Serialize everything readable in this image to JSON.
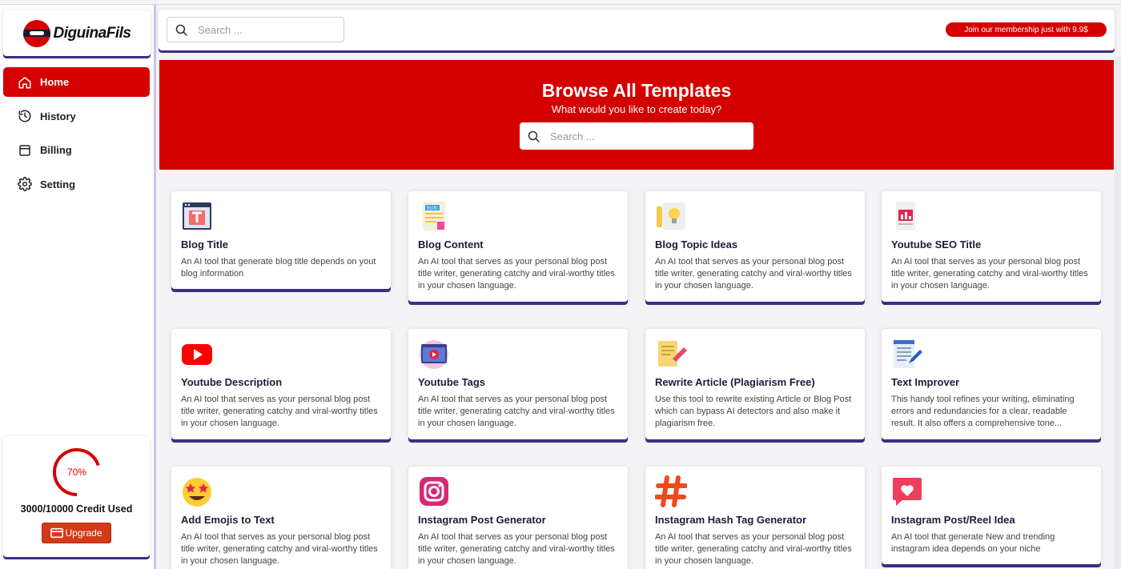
{
  "brand": {
    "name": "DiguinaFils"
  },
  "sidebar": {
    "items": [
      {
        "label": "Home",
        "icon": "home-icon",
        "active": true
      },
      {
        "label": "History",
        "icon": "history-icon",
        "active": false
      },
      {
        "label": "Billing",
        "icon": "billing-icon",
        "active": false
      },
      {
        "label": "Setting",
        "icon": "gear-icon",
        "active": false
      }
    ],
    "credits": {
      "percent_label": "70%",
      "percent": 70,
      "used_label": "3000/10000 Credit Used",
      "upgrade_label": "Upgrade"
    }
  },
  "header": {
    "search_placeholder": "Search ...",
    "membership_label": "Join our membership just with 9.9$"
  },
  "hero": {
    "title": "Browse All Templates",
    "subtitle": "What would you like to create today?",
    "search_placeholder": "Search ..."
  },
  "templates": [
    {
      "title": "Blog Title",
      "desc": "An AI tool that generate blog title depends on yout blog information",
      "icon": "blog-title-icon"
    },
    {
      "title": "Blog Content",
      "desc": "An AI tool that serves as your personal blog post title writer, generating catchy and viral-worthy titles in your chosen language.",
      "icon": "blog-content-icon"
    },
    {
      "title": "Blog Topic Ideas",
      "desc": "An AI tool that serves as your personal blog post title writer, generating catchy and viral-worthy titles in your chosen language.",
      "icon": "lightbulb-icon"
    },
    {
      "title": "Youtube SEO Title",
      "desc": "An AI tool that serves as your personal blog post title writer, generating catchy and viral-worthy titles in your chosen language.",
      "icon": "seo-chart-icon"
    },
    {
      "title": "Youtube Description",
      "desc": "An AI tool that serves as your personal blog post title writer, generating catchy and viral-worthy titles in your chosen language.",
      "icon": "youtube-icon"
    },
    {
      "title": "Youtube Tags",
      "desc": "An AI tool that serves as your personal blog post title writer, generating catchy and viral-worthy titles in your chosen language.",
      "icon": "video-tags-icon"
    },
    {
      "title": "Rewrite Article (Plagiarism Free)",
      "desc": "Use this tool to rewrite existing Article or Blog Post which can bypass AI detectors and also make it plagiarism free.",
      "icon": "pencil-paper-icon"
    },
    {
      "title": "Text Improver",
      "desc": "This handy tool refines your writing, eliminating errors and redundancies for a clear, readable result. It also offers a comprehensive tone...",
      "icon": "notepad-icon"
    },
    {
      "title": "Add Emojis to Text",
      "desc": "An AI tool that serves as your personal blog post title writer, generating catchy and viral-worthy titles in your chosen language.",
      "icon": "star-eyes-emoji-icon"
    },
    {
      "title": "Instagram Post Generator",
      "desc": "An AI tool that serves as your personal blog post title writer, generating catchy and viral-worthy titles in your chosen language.",
      "icon": "instagram-icon"
    },
    {
      "title": "Instagram Hash Tag Generator",
      "desc": "An AI tool that serves as your personal blog post title writer, generating catchy and viral-worthy titles in your chosen language.",
      "icon": "hashtag-icon"
    },
    {
      "title": "Instagram Post/Reel Idea",
      "desc": "An AI tool that generate New and trending instagram idea depends on your niche",
      "icon": "heart-message-icon"
    }
  ],
  "colors": {
    "accent": "#d50000",
    "shadow": "#3a2f86"
  }
}
